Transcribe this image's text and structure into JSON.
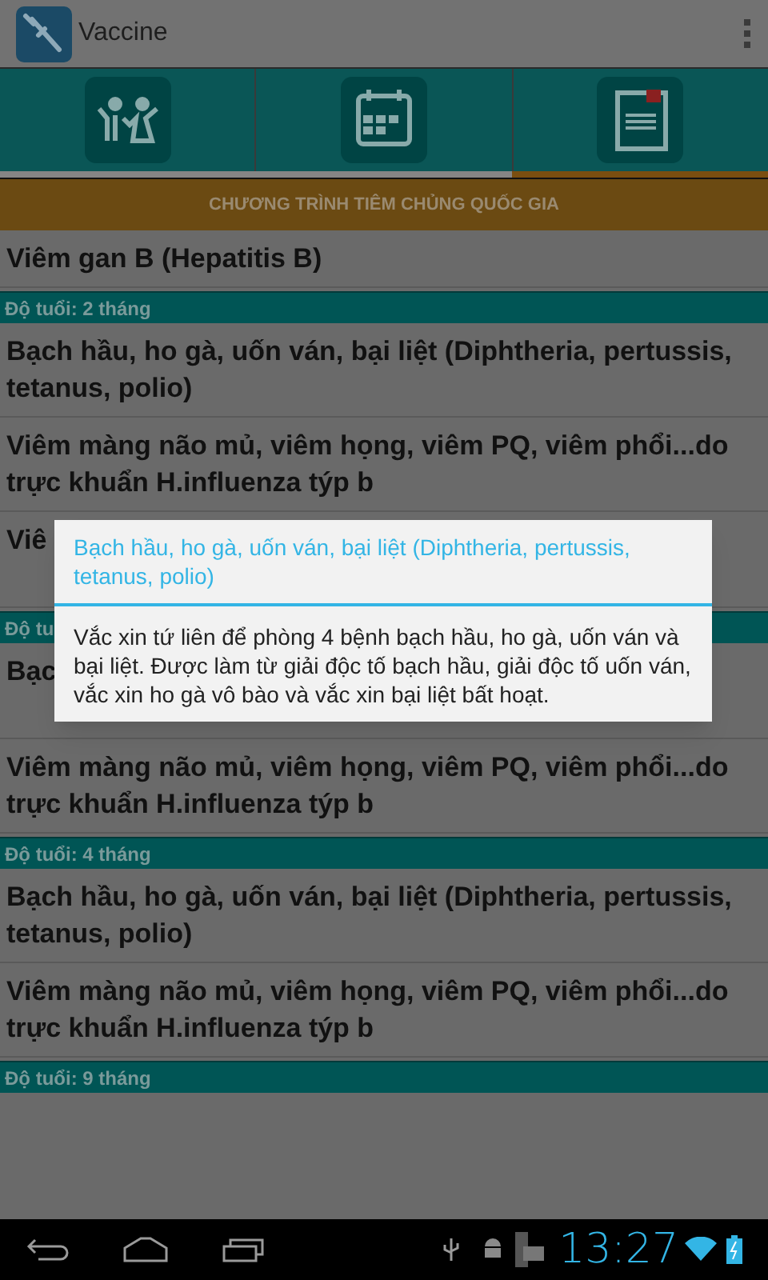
{
  "action_bar": {
    "title": "Vaccine"
  },
  "tabs": [
    {
      "selected": false
    },
    {
      "selected": false
    },
    {
      "selected": true
    }
  ],
  "banner": "CHƯƠNG TRÌNH TIÊM CHỦNG QUỐC GIA",
  "list": [
    {
      "kind": "item",
      "lines": [
        "Viêm gan B (Hepatitis B)"
      ]
    },
    {
      "kind": "header",
      "lines": [
        "Độ tuổi: 2 tháng"
      ]
    },
    {
      "kind": "item",
      "lines": [
        "Bạch hầu, ho gà, uốn ván, bại liệt (Diphtheria, pertussis, tetanus, polio)"
      ]
    },
    {
      "kind": "item",
      "lines": [
        "Viêm màng não mủ, viêm họng, viêm PQ, viêm phổi...do trực khuẩn H.influenza týp b"
      ]
    },
    {
      "kind": "item",
      "lines": [
        "Viê"
      ]
    },
    {
      "kind": "header",
      "lines": [
        "Độ tu"
      ]
    },
    {
      "kind": "item",
      "lines": [
        "Bạc"
      ]
    },
    {
      "kind": "item",
      "lines": [
        "Viêm màng não mủ, viêm họng, viêm PQ, viêm phổi...do trực khuẩn H.influenza týp b"
      ]
    },
    {
      "kind": "header",
      "lines": [
        "Độ tuổi: 4 tháng"
      ]
    },
    {
      "kind": "item",
      "lines": [
        "Bạch hầu, ho gà, uốn ván, bại liệt (Diphtheria, pertussis, tetanus, polio)"
      ]
    },
    {
      "kind": "item",
      "lines": [
        "Viêm màng não mủ, viêm họng, viêm PQ, viêm phổi...do trực khuẩn H.influenza týp b"
      ]
    },
    {
      "kind": "header",
      "lines": [
        "Độ tuổi: 9 tháng"
      ]
    }
  ],
  "dialog": {
    "title": "Bạch hầu, ho gà, uốn ván, bại liệt (Diphtheria, pertussis, tetanus, polio)",
    "body": "Vắc xin tứ liên để phòng 4 bệnh bạch hầu, ho gà, uốn ván và bại liệt. Được làm từ giải độc tố bạch hầu, giải độc tố uốn ván, vắc xin ho gà vô bào và vắc xin bại liệt bất hoạt."
  },
  "status_bar": {
    "time": "13:27"
  }
}
